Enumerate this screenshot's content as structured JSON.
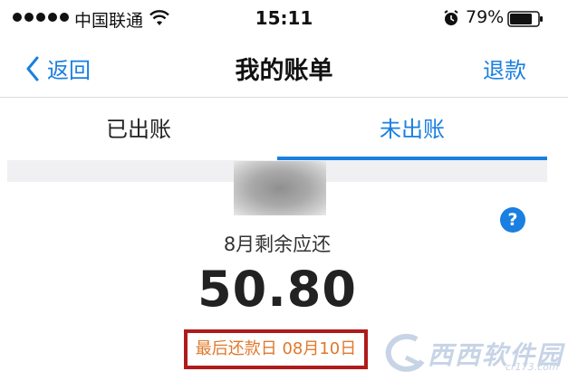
{
  "status_bar": {
    "carrier": "中国联通",
    "time": "15:11",
    "battery_percent": "79%"
  },
  "nav": {
    "back_label": "返回",
    "title": "我的账单",
    "refund_label": "退款"
  },
  "tabs": [
    {
      "label": "已出账",
      "active": false
    },
    {
      "label": "未出账",
      "active": true
    }
  ],
  "bill": {
    "month_label": "8月剩余应还",
    "amount": "50.80",
    "due_date": "最后还款日 08月10日"
  },
  "help": {
    "glyph": "?"
  },
  "watermark": {
    "text": "西西软件园",
    "sub": "cr173.com"
  },
  "colors": {
    "accent": "#1a7fe0",
    "due_text": "#e0782a",
    "highlight_border": "#b01a1a"
  }
}
